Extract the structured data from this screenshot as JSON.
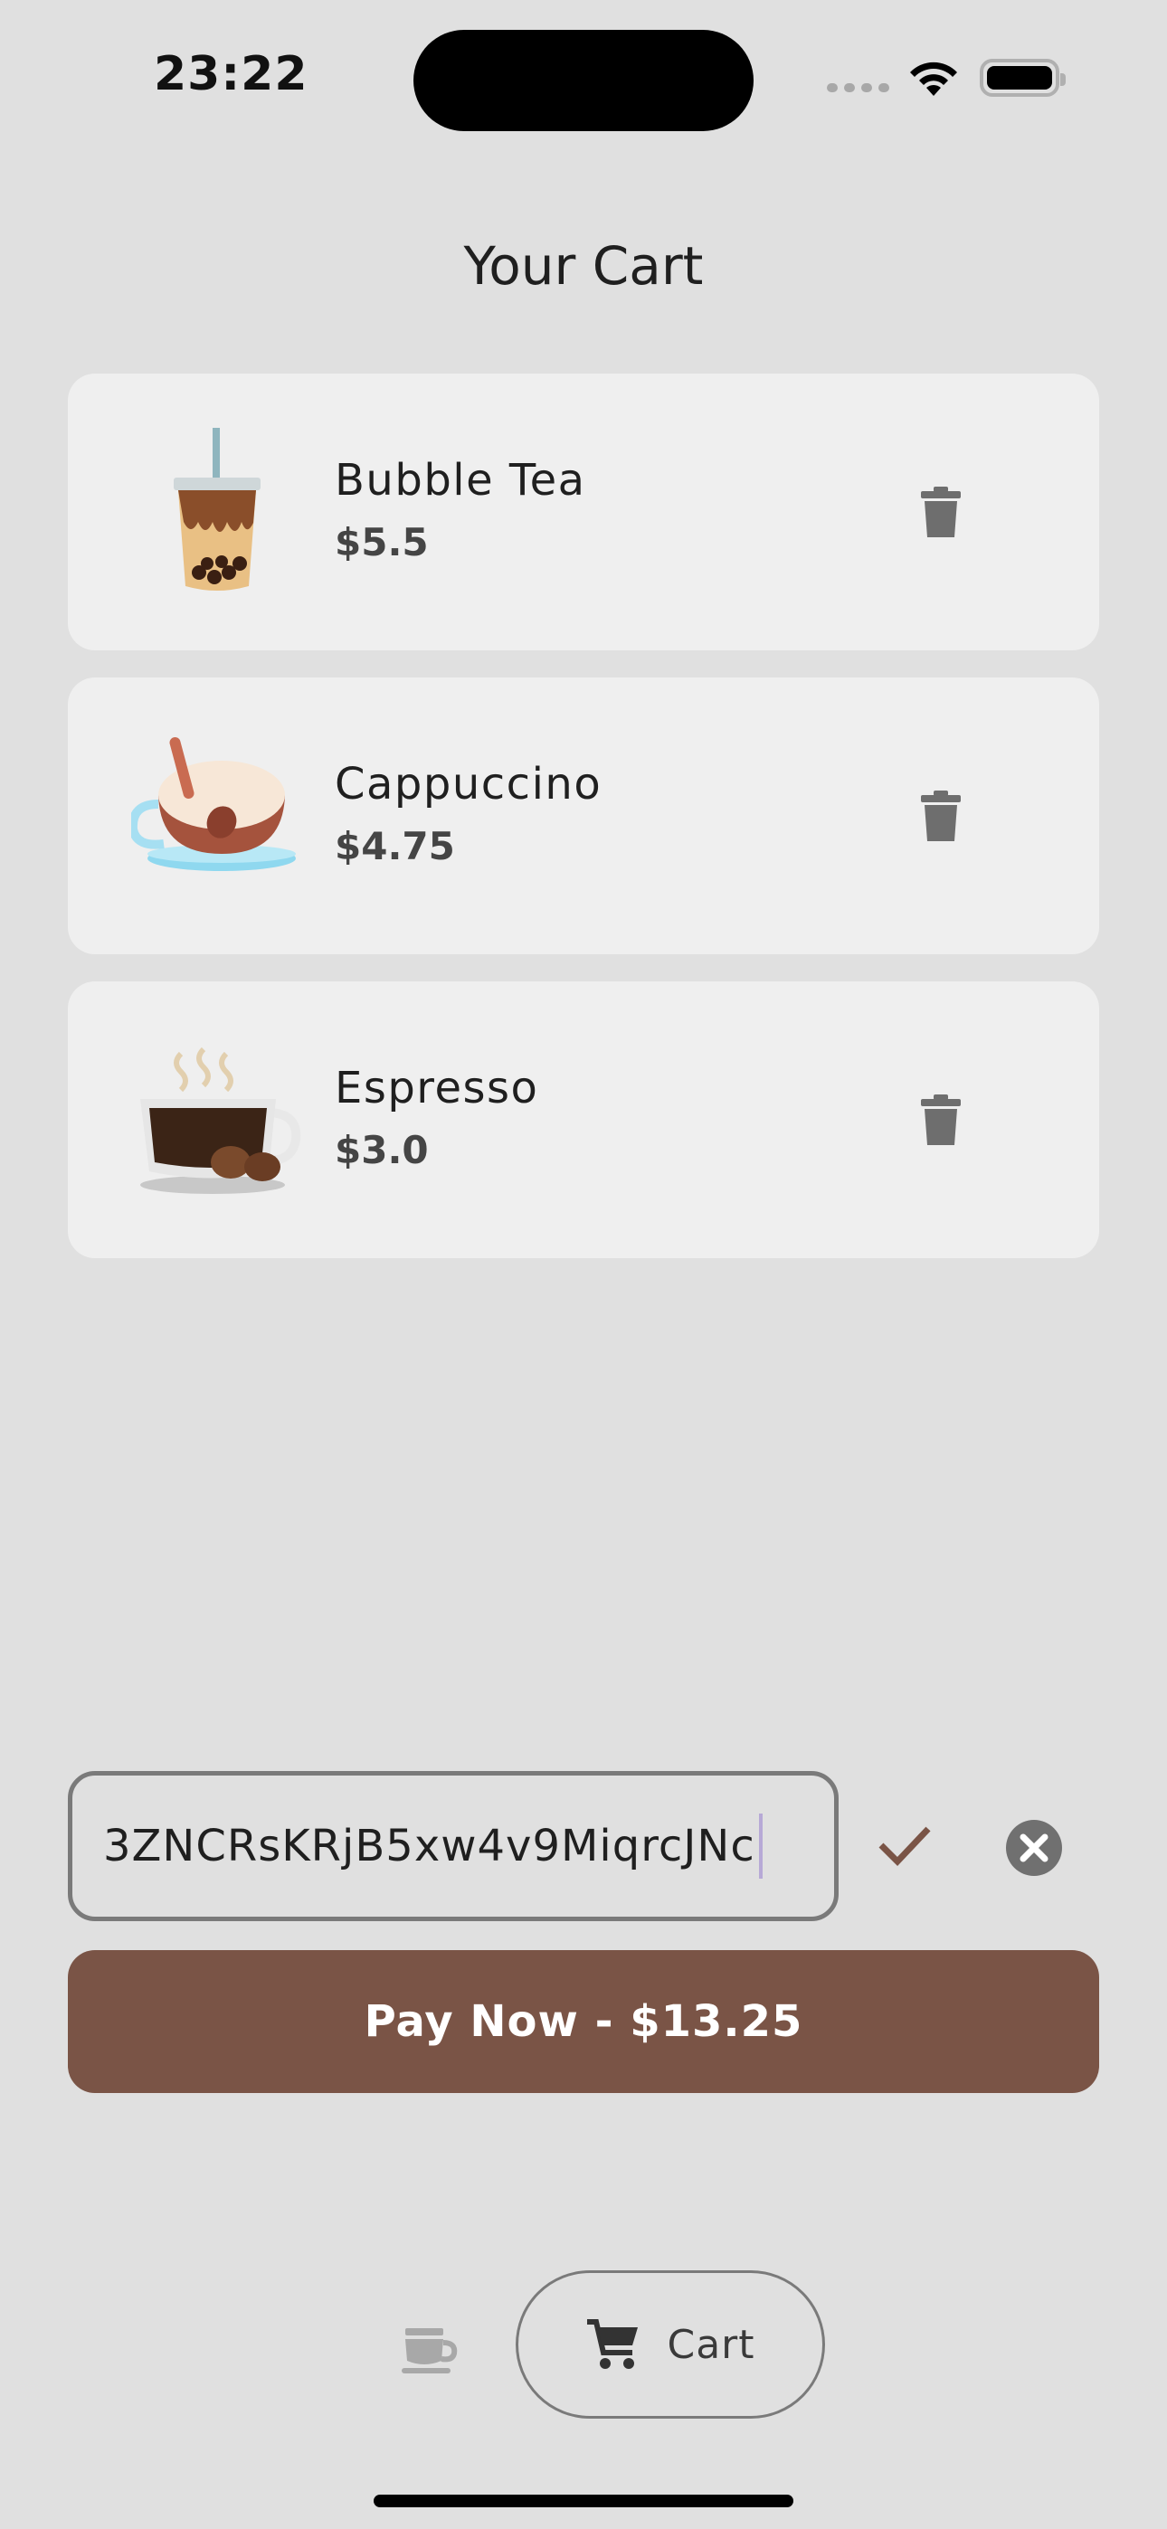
{
  "status_bar": {
    "time": "23:22"
  },
  "page": {
    "title": "Your Cart"
  },
  "cart": {
    "items": [
      {
        "name": "Bubble Tea",
        "price": "$5.5",
        "image_icon": "bubble-tea-icon"
      },
      {
        "name": "Cappuccino",
        "price": "$4.75",
        "image_icon": "cappuccino-icon"
      },
      {
        "name": "Espresso",
        "price": "$3.0",
        "image_icon": "espresso-icon"
      }
    ]
  },
  "promo": {
    "value": "3ZNCRsKRjB5xw4v9MiqrcJNc"
  },
  "checkout": {
    "pay_label": "Pay Now - $13.25"
  },
  "bottom_nav": {
    "items": [
      {
        "icon": "coffee-cup-icon",
        "label": ""
      },
      {
        "icon": "cart-icon",
        "label": "Cart",
        "active": true
      }
    ]
  },
  "colors": {
    "accent": "#7a5446",
    "background": "#e0e0e0",
    "card": "#efefef"
  }
}
